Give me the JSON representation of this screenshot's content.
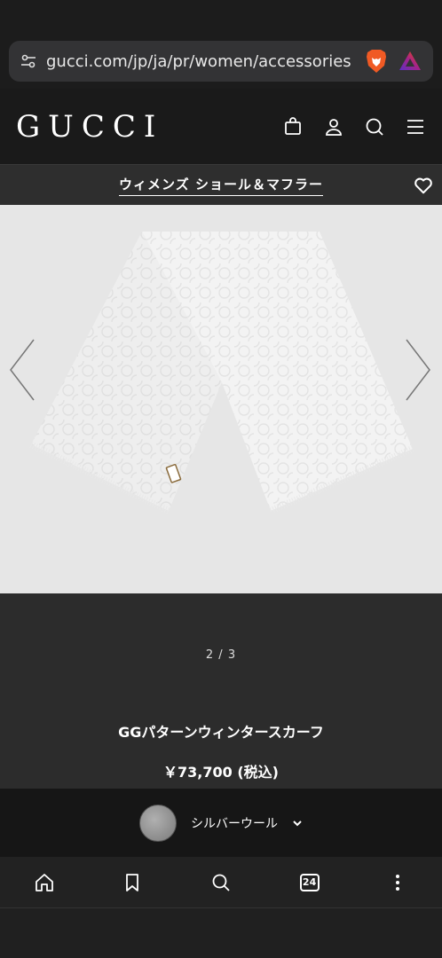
{
  "browser": {
    "url": "gucci.com/jp/ja/pr/women/accessories",
    "icons": [
      "tune-icon",
      "brave-lion-icon",
      "brave-rewards-icon"
    ]
  },
  "header": {
    "logo": "GUCCI",
    "icons": [
      "shopping-bag-icon",
      "account-icon",
      "search-icon",
      "menu-icon"
    ]
  },
  "category": {
    "title": "ウィメンズ ショール＆マフラー"
  },
  "gallery": {
    "pager": "2 / 3",
    "background": "#e6e6e6"
  },
  "product": {
    "name": "GGパターンウィンタースカーフ",
    "price": "￥73,700 (税込)"
  },
  "variant": {
    "label": "シルバーウール"
  },
  "bottom_nav": {
    "tab_count": "24",
    "items": [
      "home-icon",
      "bookmark-icon",
      "search-icon",
      "tabs-icon",
      "more-icon"
    ]
  }
}
